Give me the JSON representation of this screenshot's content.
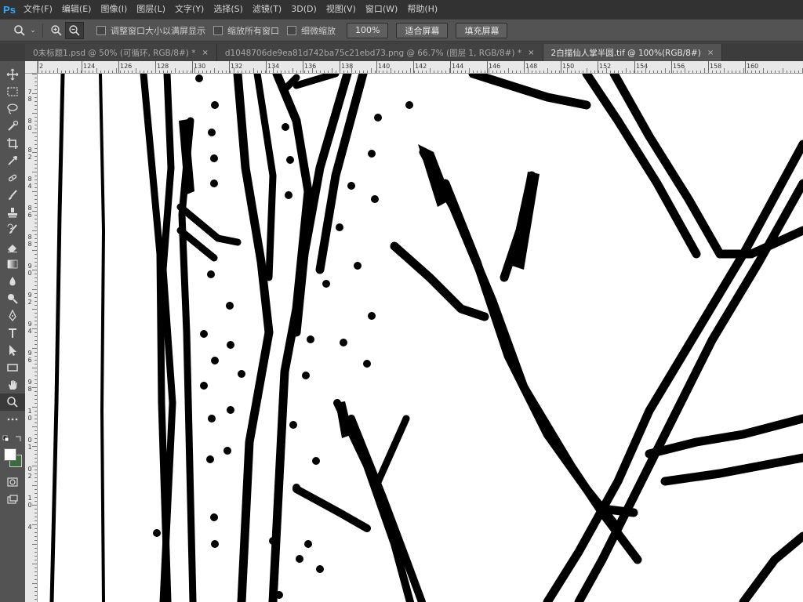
{
  "app": {
    "logo": "Ps"
  },
  "menu": [
    "文件(F)",
    "编辑(E)",
    "图像(I)",
    "图层(L)",
    "文字(Y)",
    "选择(S)",
    "滤镜(T)",
    "3D(D)",
    "视图(V)",
    "窗口(W)",
    "帮助(H)"
  ],
  "options": {
    "resize_windows": "调整窗口大小以满屏显示",
    "zoom_all": "缩放所有窗口",
    "scrubby_zoom": "细微缩放",
    "zoom_value": "100%",
    "fit_screen": "适合屏幕",
    "fill_screen": "填充屏幕"
  },
  "tabs": [
    {
      "label": "0未标题1.psd @ 50% (可循环, RGB/8#) *",
      "close": "×",
      "active": false
    },
    {
      "label": "d1048706de9ea81d742ba75c21ebd73.png @ 66.7% (图层 1, RGB/8#) *",
      "close": "×",
      "active": false
    },
    {
      "label": "2白描仙人掌半圆.tif @ 100%(RGB/8#)",
      "close": "×",
      "active": true
    }
  ],
  "ruler_h": [
    "2",
    "124",
    "126",
    "128",
    "130",
    "132",
    "134",
    "136",
    "138",
    "140",
    "142",
    "144",
    "146",
    "148",
    "150",
    "152",
    "154",
    "156",
    "158",
    "160"
  ],
  "ruler_v": [
    "7",
    "8",
    "8",
    "0",
    "8",
    "2",
    "8",
    "4",
    "8",
    "6",
    "8",
    "8",
    "9",
    "0",
    "9",
    "2",
    "9",
    "4",
    "9",
    "6",
    "9",
    "8",
    "1",
    "0",
    "0",
    "1",
    "0",
    "2",
    "1",
    "0",
    "4"
  ],
  "colors": {
    "foreground": "#ffffff",
    "background": "#3e6b3e"
  },
  "tools": [
    "move-icon",
    "marquee-icon",
    "lasso-icon",
    "quick-select-icon",
    "crop-icon",
    "eyedropper-icon",
    "healing-icon",
    "brush-icon",
    "stamp-icon",
    "history-brush-icon",
    "eraser-icon",
    "gradient-icon",
    "blur-icon",
    "dodge-icon",
    "pen-icon",
    "type-icon",
    "path-select-icon",
    "rectangle-icon",
    "hand-icon",
    "zoom-icon",
    "more-tools-icon"
  ]
}
